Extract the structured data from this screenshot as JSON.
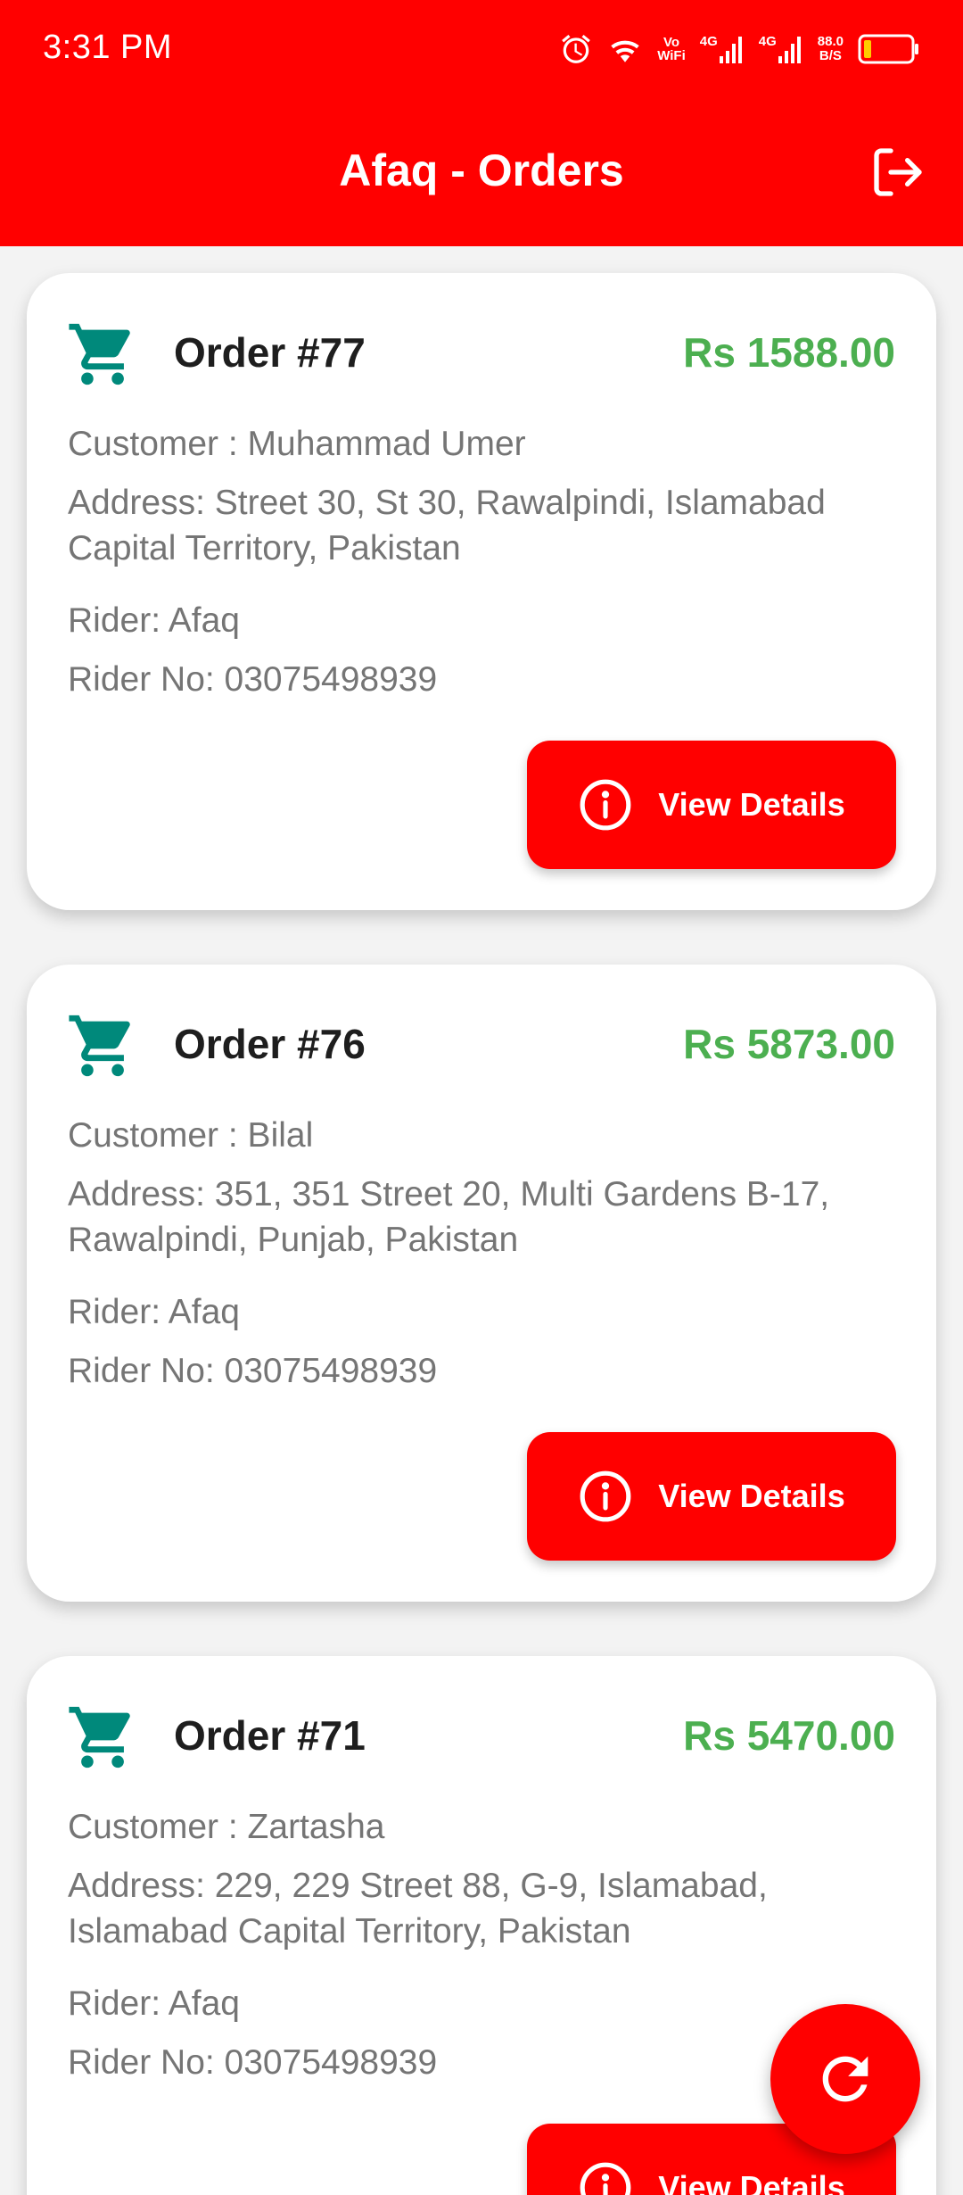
{
  "status_bar": {
    "time": "3:31 PM",
    "icons": [
      "alarm-icon",
      "wifi-icon",
      "vowifi-icon",
      "signal-4g-icon",
      "signal-4g-icon",
      "battery-icon"
    ],
    "vowifi_top": "Vo",
    "vowifi_bottom": "WiFi",
    "net1_label": "4G",
    "net2_label": "4G",
    "speed_value": "88.0",
    "speed_unit": "B/S",
    "colors": {
      "background": "#ff0000",
      "battery_fill": "#ffcc00"
    }
  },
  "app_bar": {
    "title": "Afaq - Orders",
    "logout_icon": "logout-icon"
  },
  "orders": [
    {
      "title": "Order #77",
      "amount": "Rs 1588.00",
      "customer": "Customer : Muhammad Umer",
      "address": "Address: Street 30, St 30, Rawalpindi, Islamabad Capital Territory, Pakistan",
      "rider": "Rider: Afaq",
      "rider_no": "Rider No: 03075498939",
      "button_label": "View Details"
    },
    {
      "title": "Order #76",
      "amount": "Rs 5873.00",
      "customer": "Customer : Bilal",
      "address": "Address: 351, 351 Street 20, Multi Gardens B-17, Rawalpindi, Punjab, Pakistan",
      "rider": "Rider: Afaq",
      "rider_no": "Rider No: 03075498939",
      "button_label": "View Details"
    },
    {
      "title": "Order #71",
      "amount": "Rs 5470.00",
      "customer": "Customer : Zartasha",
      "address": "Address: 229, 229 Street 88, G-9, Islamabad, Islamabad Capital Territory, Pakistan",
      "rider": "Rider: Afaq",
      "rider_no": "Rider No: 03075498939",
      "button_label": "View Details"
    }
  ],
  "fab": {
    "icon": "refresh-icon"
  },
  "colors": {
    "accent": "#ff0000",
    "amount": "#4caf50",
    "cart_icon": "#00897b",
    "title_text": "#1e1e1e",
    "body_text": "#757575",
    "background": "#f3f3f3"
  }
}
